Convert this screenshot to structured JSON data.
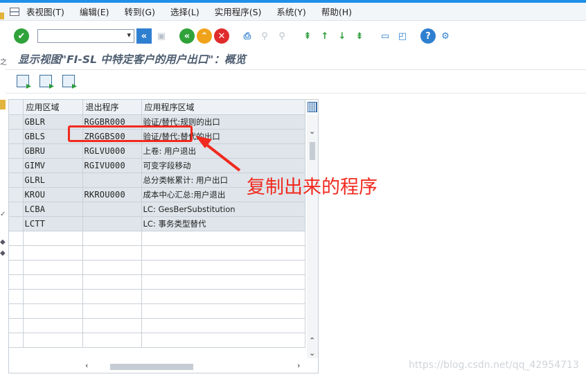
{
  "menu": {
    "items": [
      "表视图(T)",
      "编辑(E)",
      "转到(G)",
      "选择(L)",
      "实用程序(S)",
      "系统(Y)",
      "帮助(H)"
    ]
  },
  "toolbar": {
    "command_field_value": "",
    "icons": [
      "enter-check-icon",
      "command-field",
      "back-icon",
      "save-icon",
      "back-green-icon",
      "exit-up-icon",
      "cancel-icon",
      "print-icon",
      "find-icon",
      "find-next-icon",
      "first-page-icon",
      "prev-page-icon",
      "next-page-icon",
      "last-page-icon",
      "new-session-icon",
      "shortcut-icon",
      "help-icon",
      "customize-icon"
    ]
  },
  "page_title": "显示视图\"FI-SL 中特定客户的用户出口\"：概览",
  "table": {
    "columns": [
      "应用区域",
      "退出程序",
      "应用程序区域"
    ],
    "rows": [
      {
        "area": "GBLR",
        "program": "RGGBR000",
        "desc": "验证/替代:规则的出口"
      },
      {
        "area": "GBLS",
        "program": "ZRGGBS00",
        "desc": "验证/替代:替代的出口"
      },
      {
        "area": "GBRU",
        "program": "RGLVU000",
        "desc": "上卷: 用户退出"
      },
      {
        "area": "GIMV",
        "program": "RGIVU000",
        "desc": "可变字段移动"
      },
      {
        "area": "GLRL",
        "program": "",
        "desc": "总分类帐累计: 用户出口"
      },
      {
        "area": "KROU",
        "program": "RKROU000",
        "desc": "成本中心汇总:用户退出"
      },
      {
        "area": "LCBA",
        "program": "",
        "desc": "LC: GesBerSubstitution"
      },
      {
        "area": "LCTT",
        "program": "",
        "desc": "LC: 事务类型替代"
      }
    ],
    "empty_rows": 8
  },
  "annotation": "复制出来的程序",
  "watermark": "https://blog.csdn.net/qq_42954713",
  "colors": {
    "accent": "#1e90e8",
    "annotation_red": "#f12a1f"
  }
}
